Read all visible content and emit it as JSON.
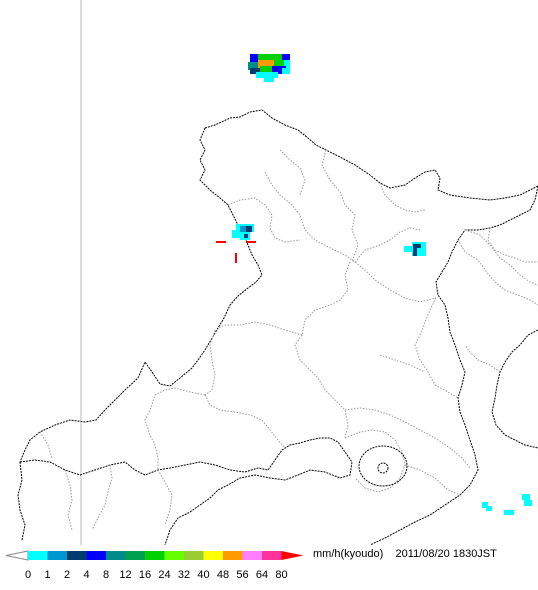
{
  "legend": {
    "unit_label": "mm/h(kyoudo)",
    "timestamp": "2011/08/20 1830JST",
    "ticks": [
      "0",
      "1",
      "2",
      "4",
      "8",
      "12",
      "16",
      "24",
      "32",
      "40",
      "48",
      "56",
      "64",
      "80"
    ],
    "colors": [
      "#00ffff",
      "#0096d0",
      "#003c70",
      "#0000ff",
      "#008b8b",
      "#00a050",
      "#00d000",
      "#66ff00",
      "#9acd32",
      "#ffff00",
      "#ff9900",
      "#ff80ff",
      "#ff3399",
      "#ff0000"
    ],
    "low_arrow_color": "#ffffff",
    "high_arrow_color": "#ff0000"
  },
  "marker": {
    "color": "#ff0000",
    "symbol": "crosshair"
  },
  "map": {
    "line_color": "#000000",
    "boundary_color": "#999999",
    "background": "#ffffff"
  }
}
